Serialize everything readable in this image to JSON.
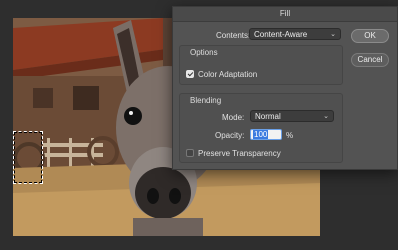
{
  "dialog": {
    "title": "Fill",
    "contents_label": "Contents:",
    "contents_value": "Content-Aware",
    "options_title": "Options",
    "color_adaptation_label": "Color Adaptation",
    "color_adaptation_checked": true,
    "blending_title": "Blending",
    "mode_label": "Mode:",
    "mode_value": "Normal",
    "opacity_label": "Opacity:",
    "opacity_value": "100",
    "opacity_unit": "%",
    "preserve_transparency_label": "Preserve Transparency",
    "preserve_transparency_checked": false,
    "ok_label": "OK",
    "cancel_label": "Cancel"
  },
  "icons": {
    "dropdown": "chevron-down-icon",
    "checkbox": "checkbox-icon"
  },
  "colors": {
    "dialog_bg": "#535353",
    "selection_highlight": "#3b7be0"
  }
}
